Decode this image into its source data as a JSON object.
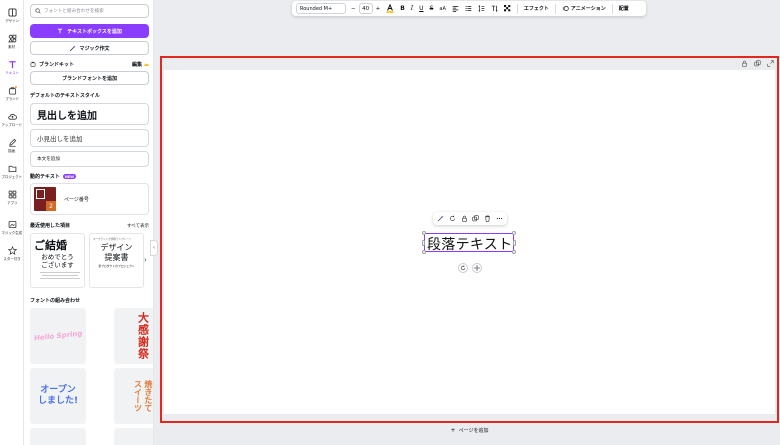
{
  "rail": {
    "items": [
      {
        "label": "デザイン",
        "icon": "template-icon"
      },
      {
        "label": "素材",
        "icon": "elements-icon"
      },
      {
        "label": "テキスト",
        "icon": "text-icon",
        "active": true
      },
      {
        "label": "ブランド",
        "icon": "brand-icon"
      },
      {
        "label": "アップロード",
        "icon": "upload-icon"
      },
      {
        "label": "描画",
        "icon": "draw-icon"
      },
      {
        "label": "プロジェクト",
        "icon": "folder-icon"
      },
      {
        "label": "アプリ",
        "icon": "apps-icon"
      },
      {
        "label": "マジック生成",
        "icon": "magic-media-icon"
      },
      {
        "label": "スター付き",
        "icon": "star-icon"
      }
    ]
  },
  "panel": {
    "search_placeholder": "フォントと組み合わせを検索",
    "add_textbox": "テキストボックスを追加",
    "magic_write": "マジック作文",
    "brand_kit": "ブランドキット",
    "brand_edit": "編集",
    "add_brand_fonts": "ブランドフォントを追加",
    "default_styles_title": "デフォルトのテキストスタイル",
    "heading": "見出しを追加",
    "subheading": "小見出しを追加",
    "body": "本文を追加",
    "dynamic_title": "動的テキスト",
    "new_badge": "NEW",
    "page_number": "ページ番号",
    "page_number_digit": "2",
    "recent_title": "最近使用した項目",
    "see_all": "すべて表示",
    "recent1": {
      "title": "ご結婚",
      "sub": "おめでとう\nございます"
    },
    "recent2": {
      "caption": "マーケティング資料テンプレート",
      "title": "デザイン\n提案書",
      "sub": "新プロダクトのプロジェクト"
    },
    "combos_title": "フォントの組み合わせ",
    "combo1": "Hello Spring",
    "combo2": "大感謝祭",
    "combo3": "オープン\nしました!",
    "combo4": "焼きたて\nスイーツ"
  },
  "toolbar": {
    "font": "Rounded M+",
    "minus": "−",
    "size": "40",
    "plus": "+",
    "effects": "エフェクト",
    "animate": "アニメーション",
    "position": "配置"
  },
  "canvas": {
    "text": "段落テキスト",
    "add_page": "ページを追加"
  },
  "colors": {
    "accent": "#8b3dff",
    "highlight": "#e0281f"
  }
}
